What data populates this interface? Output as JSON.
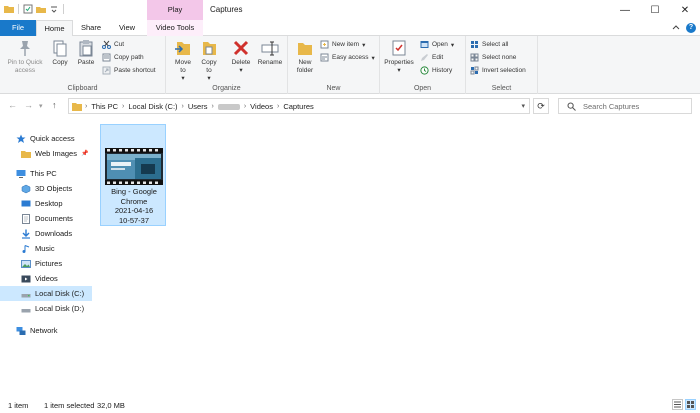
{
  "window": {
    "title": "Captures",
    "context_tab": "Play",
    "controls": {
      "minimize": "—",
      "maximize": "☐",
      "close": "✕"
    }
  },
  "tabs": {
    "file": "File",
    "home": "Home",
    "share": "Share",
    "view": "View",
    "video_tools": "Video Tools"
  },
  "ribbon": {
    "clipboard": {
      "label": "Clipboard",
      "pin": "Pin to Quick access",
      "copy": "Copy",
      "paste": "Paste",
      "cut": "Cut",
      "copy_path": "Copy path",
      "paste_shortcut": "Paste shortcut"
    },
    "organize": {
      "label": "Organize",
      "move_to": "Move to",
      "copy_to": "Copy to",
      "delete": "Delete",
      "rename": "Rename"
    },
    "new": {
      "label": "New",
      "new_folder": "New folder",
      "new_item": "New item",
      "easy_access": "Easy access"
    },
    "open": {
      "label": "Open",
      "properties": "Properties",
      "open": "Open",
      "edit": "Edit",
      "history": "History"
    },
    "select": {
      "label": "Select",
      "select_all": "Select all",
      "select_none": "Select none",
      "invert": "Invert selection"
    }
  },
  "address": {
    "crumbs": [
      "This PC",
      "Local Disk (C:)",
      "Users",
      "Videos",
      "Captures"
    ],
    "search_placeholder": "Search Captures"
  },
  "sidebar": {
    "items": [
      {
        "label": "Quick access",
        "icon": "star-icon"
      },
      {
        "label": "Web Images",
        "icon": "folder-icon"
      },
      {
        "label": "This PC",
        "icon": "computer-icon"
      },
      {
        "label": "3D Objects",
        "icon": "cube-icon"
      },
      {
        "label": "Desktop",
        "icon": "desktop-icon"
      },
      {
        "label": "Documents",
        "icon": "documents-icon"
      },
      {
        "label": "Downloads",
        "icon": "download-icon"
      },
      {
        "label": "Music",
        "icon": "music-icon"
      },
      {
        "label": "Pictures",
        "icon": "pictures-icon"
      },
      {
        "label": "Videos",
        "icon": "videos-icon"
      },
      {
        "label": "Local Disk (C:)",
        "icon": "drive-icon"
      },
      {
        "label": "Local Disk (D:)",
        "icon": "drive-icon"
      },
      {
        "label": "Network",
        "icon": "network-icon"
      }
    ]
  },
  "files": [
    {
      "name_line1": "Bing - Google",
      "name_line2": "Chrome",
      "name_line3": "2021-04-16",
      "name_line4": "10-57-37"
    }
  ],
  "status": {
    "count": "1 item",
    "selected": "1 item selected",
    "size": "32,0 MB"
  },
  "colors": {
    "accent": "#1979ca",
    "selection": "#cce8ff",
    "context_tab": "#f3c7e9"
  }
}
